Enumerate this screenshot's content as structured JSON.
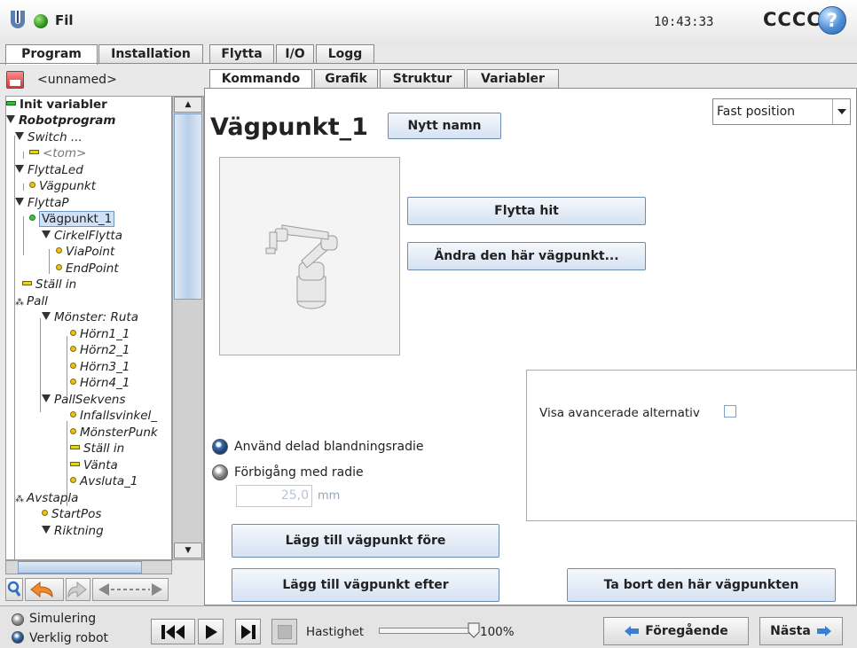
{
  "header": {
    "file_label": "Fil",
    "clock": "10:43:33",
    "robot_name": "CCCC",
    "help_glyph": "?"
  },
  "main_tabs": [
    {
      "label": "Program",
      "active": true
    },
    {
      "label": "Installation",
      "active": false
    },
    {
      "label": "Flytta",
      "active": false
    },
    {
      "label": "I/O",
      "active": false
    },
    {
      "label": "Logg",
      "active": false
    }
  ],
  "program_name": "<unnamed>",
  "sub_tabs": [
    {
      "label": "Kommando",
      "active": true
    },
    {
      "label": "Grafik",
      "active": false
    },
    {
      "label": "Struktur",
      "active": false
    },
    {
      "label": "Variabler",
      "active": false
    }
  ],
  "tree": {
    "items": [
      "Init variabler",
      "Robotprogram",
      "Switch ...",
      "<tom>",
      "FlyttaLed",
      "Vägpunkt",
      "FlyttaP",
      "Vägpunkt_1",
      "CirkelFlytta",
      "ViaPoint",
      "EndPoint",
      "Ställ in",
      "Pall",
      "Mönster: Ruta",
      "Hörn1_1",
      "Hörn2_1",
      "Hörn3_1",
      "Hörn4_1",
      "PallSekvens",
      "Infallsvinkel_",
      "MönsterPunk",
      "Ställ in",
      "Vänta",
      "Avsluta_1",
      "Avstapla",
      "StartPos",
      "Riktning"
    ],
    "selected_index": 7
  },
  "command": {
    "waypoint_title": "Vägpunkt_1",
    "rename_label": "Nytt namn",
    "position_mode": "Fast position",
    "move_here_label": "Flytta hit",
    "change_waypoint_label": "Ändra den här vägpunkt...",
    "advanced_label": "Visa avancerade alternativ",
    "advanced_checked": false,
    "blend_shared_label": "Använd delad blandningsradie",
    "blend_radius_label": "Förbigång med radie",
    "radius_value": "25,0",
    "radius_unit": "mm",
    "add_before_label": "Lägg till vägpunkt före",
    "add_after_label": "Lägg till vägpunkt efter",
    "remove_label": "Ta bort den här vägpunkten"
  },
  "footer": {
    "simulation_label": "Simulering",
    "real_robot_label": "Verklig robot",
    "speed_label": "Hastighet",
    "speed_value": "100%",
    "speed_fraction": 1.0,
    "previous_label": "Föregående",
    "next_label": "Nästa"
  },
  "colors": {
    "accent": "#3b6fb0",
    "status_green": "#2f8f1f",
    "button_top": "#f5f8fc",
    "button_bottom": "#d5e2f2"
  }
}
